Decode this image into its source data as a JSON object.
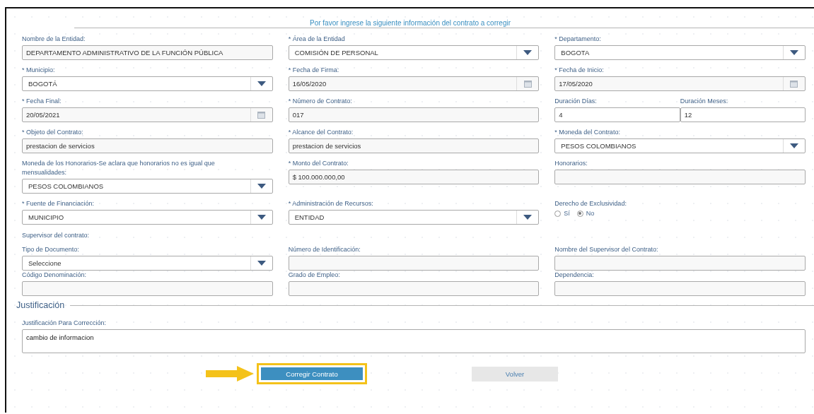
{
  "title": "Por favor ingrese la siguiente información del contrato a corregir",
  "fields": [
    {
      "kind": "text",
      "label": "Nombre de la Entidad:",
      "value": "DEPARTAMENTO ADMINISTRATIVO DE LA FUNCIÓN PÚBLICA"
    },
    {
      "kind": "select",
      "label": "* Área de la Entidad",
      "value": "COMISIÓN DE PERSONAL"
    },
    {
      "kind": "select",
      "label": "* Departamento:",
      "value": "BOGOTA"
    },
    {
      "kind": "select",
      "label": "* Municipio:",
      "value": "BOGOTÁ"
    },
    {
      "kind": "date",
      "label": "* Fecha de Firma:",
      "value": "16/05/2020"
    },
    {
      "kind": "date",
      "label": "* Fecha de Inicio:",
      "value": "17/05/2020"
    },
    {
      "kind": "date",
      "label": "* Fecha Final:",
      "value": "20/05/2021"
    },
    {
      "kind": "text",
      "label": "* Número de Contrato:",
      "value": "017"
    },
    {
      "kind": "split",
      "parts": [
        {
          "label": "Duración Días:",
          "value": "4"
        },
        {
          "label": "Duración Meses:",
          "value": "12"
        }
      ]
    },
    {
      "kind": "text",
      "label": "* Objeto del Contrato:",
      "value": "prestacion de servicios"
    },
    {
      "kind": "text",
      "label": "* Alcance del Contrato:",
      "value": "prestacion de servicios"
    },
    {
      "kind": "select",
      "label": "* Moneda del Contrato:",
      "value": "PESOS COLOMBIANOS"
    },
    {
      "kind": "select",
      "label": "Moneda de los Honorarios-Se aclara que honorarios no es igual que mensualidades:",
      "value": "PESOS COLOMBIANOS"
    },
    {
      "kind": "text",
      "label": "* Monto del Contrato:",
      "value": "$ 100.000.000,00"
    },
    {
      "kind": "text",
      "label": "Honorarios:"
    },
    {
      "kind": "select",
      "label": "* Fuente de Financiación:",
      "value": "MUNICIPIO"
    },
    {
      "kind": "select",
      "label": "* Administración de Recursos:",
      "value": "ENTIDAD"
    },
    {
      "kind": "radio",
      "label": "Derecho de Exclusividad:",
      "options": [
        {
          "label": "Sí",
          "selected": false
        },
        {
          "label": "No",
          "selected": true
        }
      ]
    }
  ],
  "supervisor": {
    "title": "Supervisor del contrato:",
    "fields": [
      {
        "kind": "select",
        "label": "Tipo de Documento:",
        "value": "Seleccione"
      },
      {
        "kind": "text",
        "label": "Número de Identificación:"
      },
      {
        "kind": "text",
        "label": "Nombre del Supervisor del Contrato:"
      },
      {
        "kind": "text",
        "label": "Código Denominación:"
      },
      {
        "kind": "text",
        "label": "Grado de Empleo:"
      },
      {
        "kind": "text",
        "label": "Dependencia:"
      }
    ]
  },
  "justification": {
    "legend": "Justificación",
    "label": "Justificación Para Corrección:",
    "value": "cambio de informacion"
  },
  "buttons": [
    {
      "label": "Corregir Contrato",
      "kind": "primary",
      "highlighted": true
    },
    {
      "label": "Volver",
      "kind": "secondary",
      "highlighted": false
    }
  ]
}
